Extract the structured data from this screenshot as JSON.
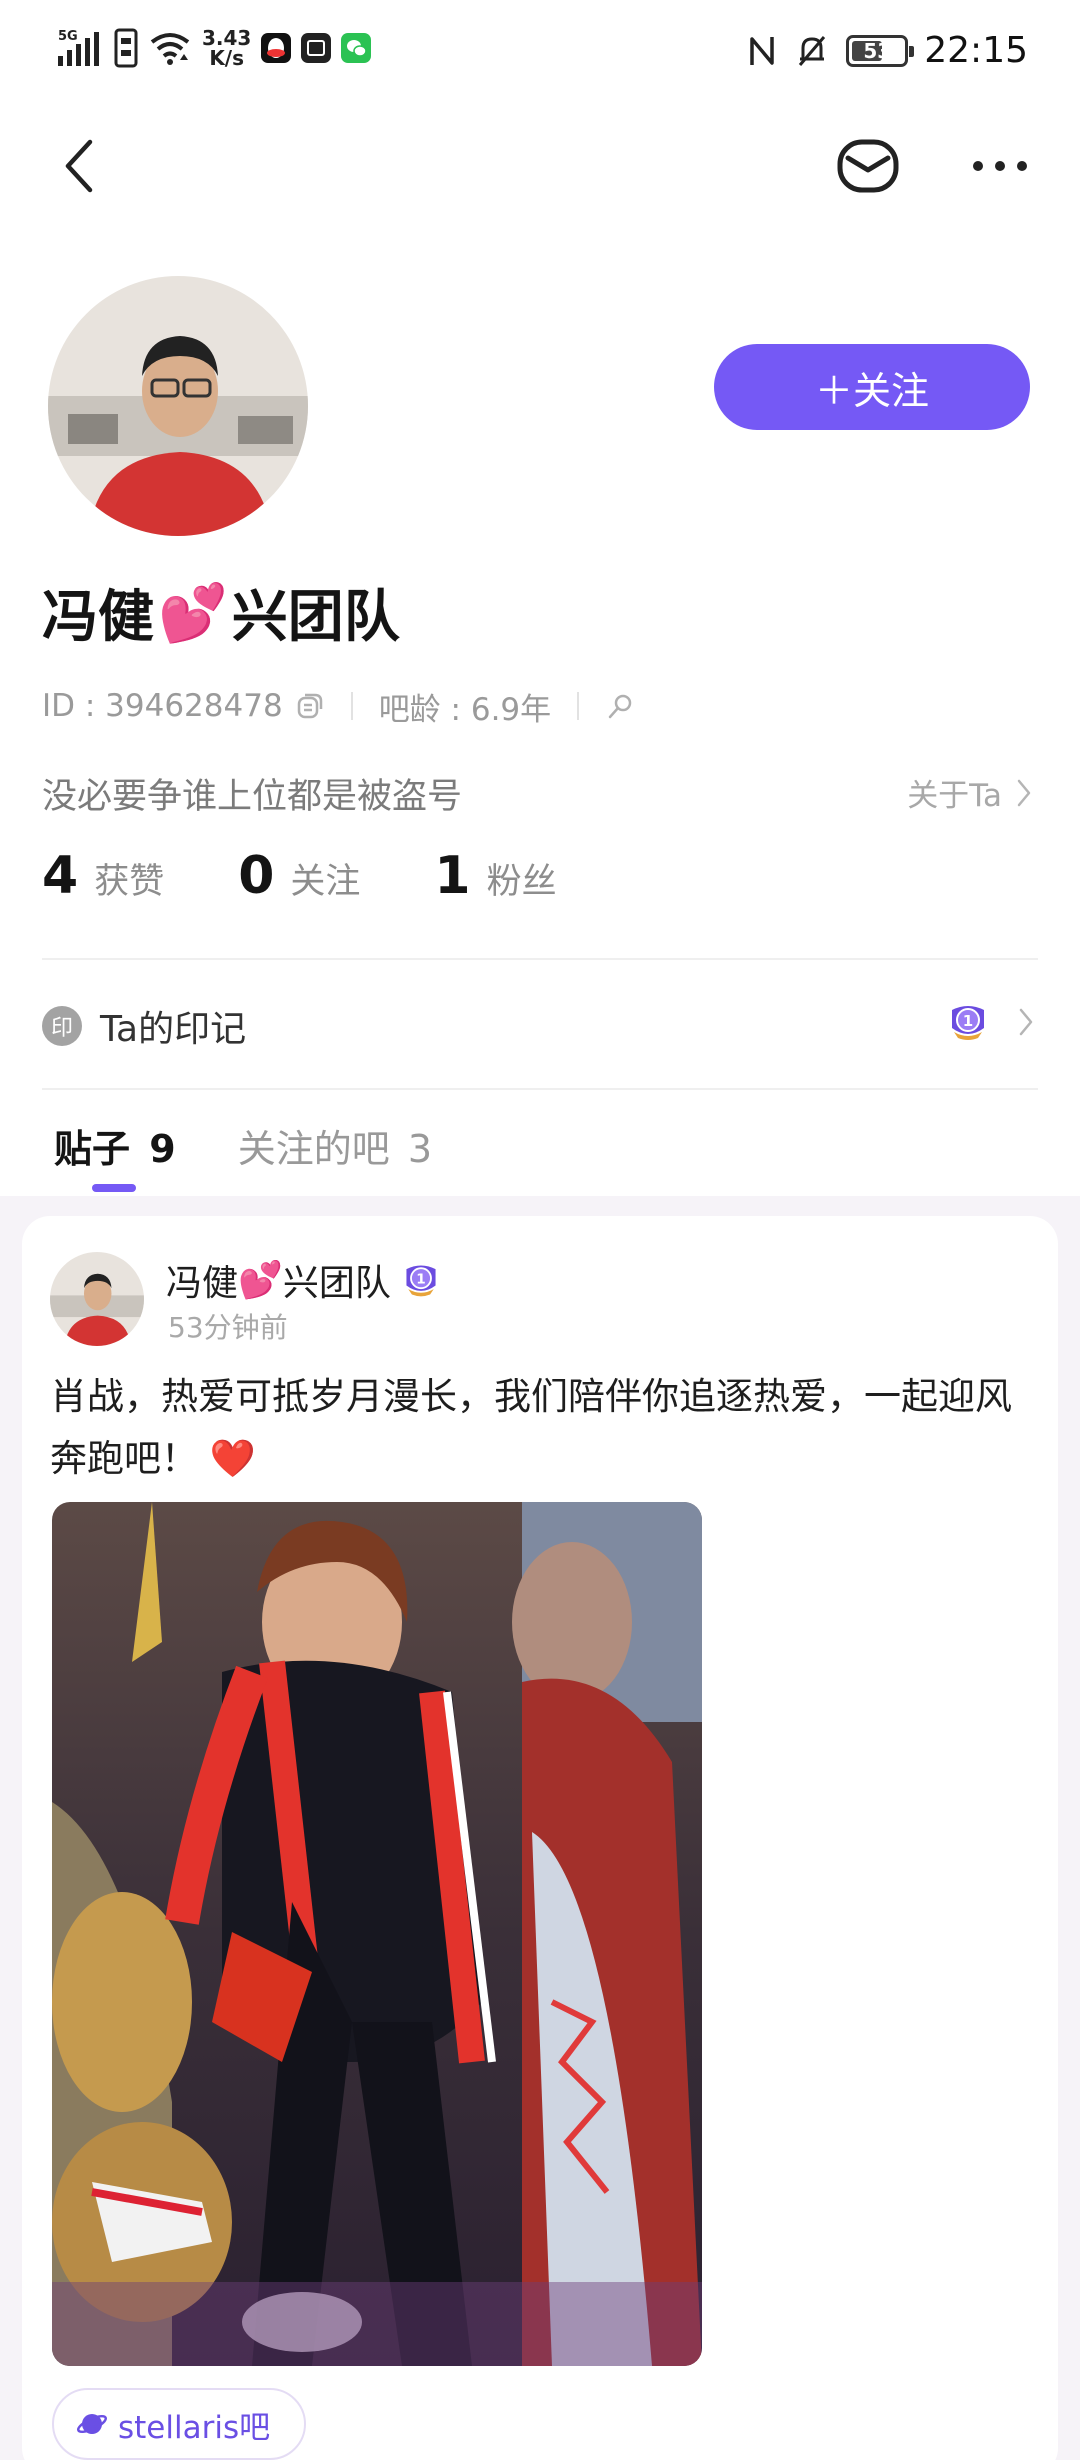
{
  "status_bar": {
    "network_label": "5G",
    "speed_value": "3.43",
    "speed_unit": "K/s",
    "battery": "53",
    "battery_level": 0.53,
    "time": "22:15"
  },
  "nav": {
    "back_icon": "chevron-left-icon",
    "mail_icon": "mail-icon",
    "more_icon": "more-dots-icon"
  },
  "profile": {
    "follow_button": "＋关注",
    "name_part1": "冯健",
    "name_emoji": "💕",
    "name_part2": "兴团队",
    "id_text": "ID : 394628478",
    "age_text": "吧龄 : 6.9年",
    "bio": "没必要争谁上位都是被盗号",
    "about_link": "关于Ta",
    "stats": [
      {
        "value": "4",
        "label": "获赞"
      },
      {
        "value": "0",
        "label": "关注"
      },
      {
        "value": "1",
        "label": "粉丝"
      }
    ],
    "badge_seal": "印",
    "badge_label": "Ta的印记",
    "badge_medal": "1"
  },
  "tabs": {
    "posts_label": "贴子",
    "posts_count": "9",
    "forums_label": "关注的吧",
    "forums_count": "3"
  },
  "post": {
    "author_part1": "冯健",
    "author_emoji": "💕",
    "author_part2": "兴团队",
    "author_medal": "1",
    "time": "53分钟前",
    "text": "肖战，热爱可抵岁月漫长，我们陪伴你追逐热爱，一起迎风奔跑吧！",
    "text_emoji": "❤️",
    "forum_tag": "stellaris吧"
  },
  "colors": {
    "accent": "#7559f5",
    "background": "#ffffff",
    "feed_background": "#f6f3f8"
  }
}
